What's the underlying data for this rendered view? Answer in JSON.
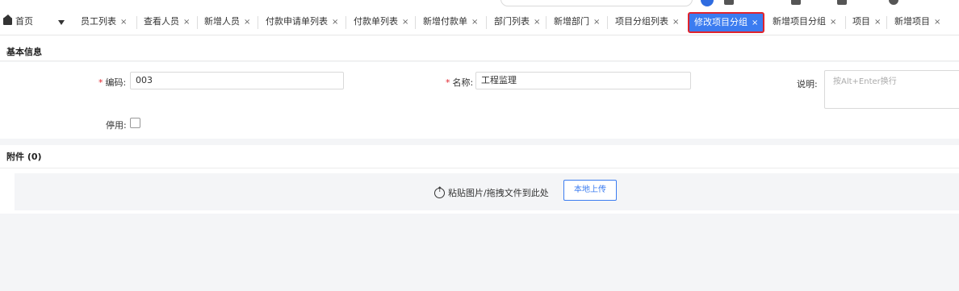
{
  "top": {
    "search_placeholder": "",
    "breadcrumb": ""
  },
  "tabs": [
    {
      "label": "首页",
      "closable": false
    },
    {
      "label": "员工列表",
      "closable": true
    },
    {
      "label": "查看人员",
      "closable": true
    },
    {
      "label": "新增人员",
      "closable": true
    },
    {
      "label": "付款申请单列表",
      "closable": true
    },
    {
      "label": "付款单列表",
      "closable": true
    },
    {
      "label": "新增付款单",
      "closable": true
    },
    {
      "label": "部门列表",
      "closable": true
    },
    {
      "label": "新增部门",
      "closable": true
    },
    {
      "label": "项目分组列表",
      "closable": true
    },
    {
      "label": "修改项目分组",
      "closable": true,
      "active": true
    },
    {
      "label": "新增项目分组",
      "closable": true
    },
    {
      "label": "项目",
      "closable": true
    },
    {
      "label": "新增项目",
      "closable": true
    }
  ],
  "close_glyph": "×",
  "basic": {
    "section_title": "基本信息",
    "code_label": "编码:",
    "code_value": "003",
    "name_label": "名称:",
    "name_value": "工程监理",
    "desc_label": "说明:",
    "desc_placeholder": "按Alt+Enter换行",
    "disabled_label": "停用:",
    "disabled_checked": false,
    "required_mark": "*"
  },
  "attachments": {
    "section_title": "附件 (0)",
    "dropzone_text": "粘贴图片/拖拽文件到此处",
    "upload_button": "本地上传"
  },
  "colors": {
    "active_tab_bg": "#3b7cf0",
    "active_tab_border": "#e0242d",
    "required": "#e0242d"
  }
}
